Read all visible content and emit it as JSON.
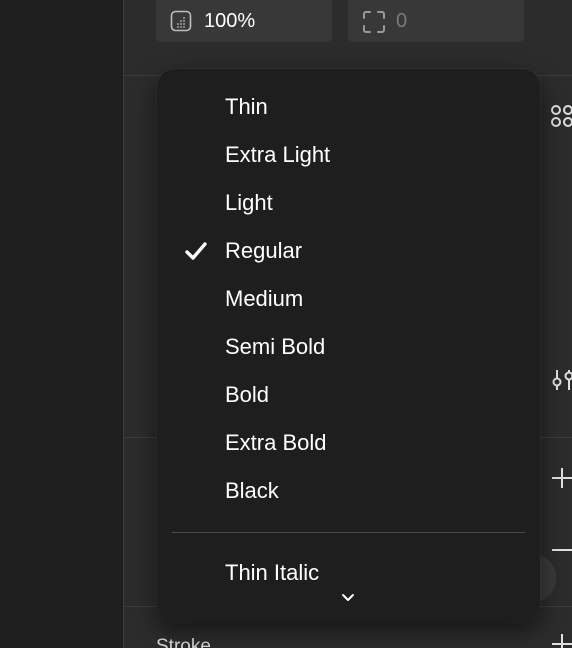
{
  "appearance": {
    "opacity_value": "100%",
    "corner_radius_value": "0"
  },
  "font_weight_menu": {
    "items": [
      {
        "label": "Thin",
        "selected": false
      },
      {
        "label": "Extra Light",
        "selected": false
      },
      {
        "label": "Light",
        "selected": false
      },
      {
        "label": "Regular",
        "selected": true
      },
      {
        "label": "Medium",
        "selected": false
      },
      {
        "label": "Semi Bold",
        "selected": false
      },
      {
        "label": "Bold",
        "selected": false
      },
      {
        "label": "Extra Bold",
        "selected": false
      },
      {
        "label": "Black",
        "selected": false
      }
    ],
    "italic_items": [
      {
        "label": "Thin Italic",
        "selected": false
      }
    ],
    "icons": {
      "selected": "checkmark-icon",
      "more": "chevron-down-icon"
    }
  },
  "panel": {
    "stroke_label": "Stroke",
    "icons": [
      "four-dots-icon",
      "adjust-sliders-icon",
      "plus-icon",
      "minus-icon",
      "plus-icon"
    ]
  },
  "colors": {
    "menu_bg": "#1e1e1e",
    "panel_bg": "#2c2c2c",
    "field_bg": "#383838",
    "text": "#ffffff",
    "muted_text": "#7a7a7a"
  }
}
